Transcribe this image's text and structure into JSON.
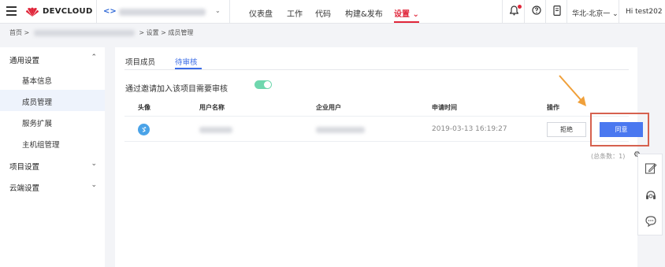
{
  "topbar": {
    "brand": "DEVCLOUD",
    "project_icon": "<>",
    "project_caret": "⌄",
    "nav": [
      "仪表盘",
      "工作",
      "代码",
      "构建&发布",
      "设置"
    ],
    "active_nav_caret": "⌄",
    "region": "华北-北京一 ⌄",
    "user": "Hi test202 ⌄",
    "icons": [
      "hamburger-icon",
      "huawei-logo",
      "bell-icon",
      "help-icon",
      "mobile-icon"
    ],
    "accent": "#e0263a"
  },
  "breadcrumb": {
    "home": "首页 >",
    "tail": "> 设置 > 成员管理"
  },
  "sidebar": {
    "groups": [
      {
        "label": "通用设置",
        "chevron": "⌃",
        "items": [
          "基本信息",
          "成员管理",
          "服务扩展",
          "主机组管理"
        ]
      },
      {
        "label": "项目设置",
        "chevron": "⌄"
      },
      {
        "label": "云端设置",
        "chevron": "⌄"
      }
    ],
    "active_item": "成员管理"
  },
  "main": {
    "tabs": [
      "项目成员",
      "待审核"
    ],
    "active_tab": "待审核",
    "setting_label": "通过邀请加入该项目需要审核",
    "toggle_on": true,
    "columns": [
      "头像",
      "用户名称",
      "企业用户",
      "申请时间",
      "操作"
    ],
    "rows": [
      {
        "avatar_glyph": "ゞ",
        "request_time": "2019-03-13 16:19:27",
        "reject": "拒绝",
        "approve": "同意"
      }
    ],
    "total": "(总条数：1)",
    "gear": "⚙"
  },
  "floatbar": {
    "icons": [
      "edit-note-icon",
      "headset-icon",
      "chat-icon"
    ]
  },
  "colors": {
    "primary": "#4a78f0",
    "tab_active": "#3b6ce6",
    "toggle": "#6fd7ae",
    "highlight_box": "#d6614f",
    "arrow": "#f0a03a"
  }
}
